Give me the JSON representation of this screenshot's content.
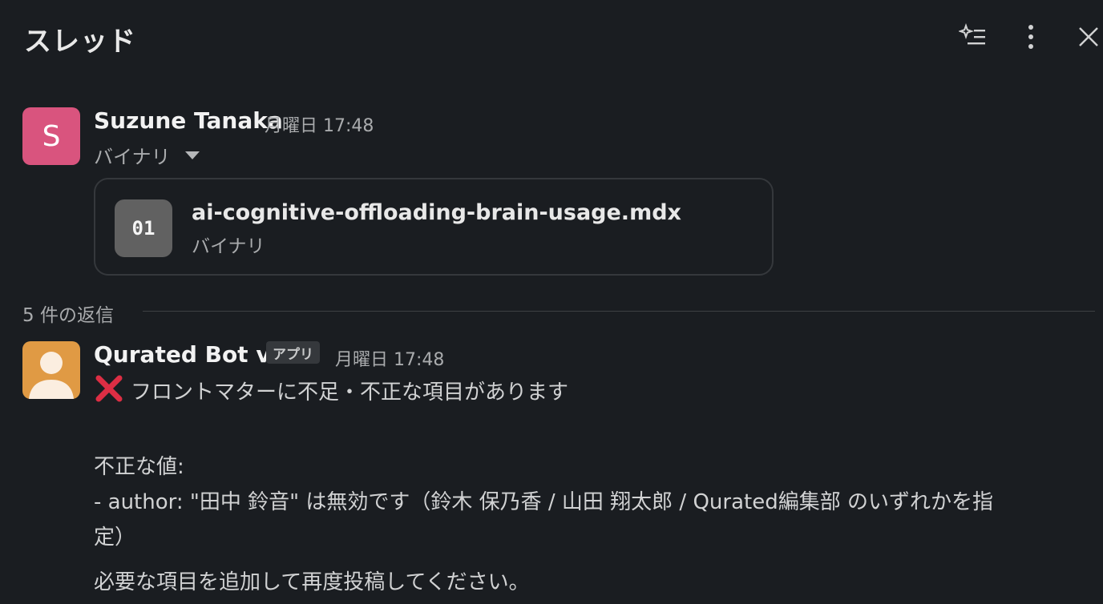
{
  "header": {
    "title": "スレッド",
    "icons": [
      "ai-summary-icon",
      "more-vertical-icon",
      "close-icon"
    ]
  },
  "parent_message": {
    "avatar_letter": "S",
    "avatar_color": "#d9547e",
    "author": "Suzune Tanaka",
    "timestamp": "月曜日 17:48",
    "subline": "バイナリ",
    "file": {
      "icon_label": "01",
      "name": "ai-cognitive-offloading-brain-usage.mdx",
      "type": "バイナリ"
    }
  },
  "replies": {
    "count_label": "5 件の返信"
  },
  "reply_message": {
    "author": "Qurated Bot v2",
    "badge": "アプリ",
    "timestamp": "月曜日 17:48",
    "avatar_color": "#e09a44",
    "lines": {
      "headline": "フロントマターに不足・不正な項目があります",
      "invalid_label": "不正な値:",
      "invalid_detail_1": "- author: \"田中 鈴音\" は無効です（鈴木 保乃香 / 山田 翔太郎 / Qurated編集部 のいずれかを指",
      "invalid_detail_2": "定）",
      "request": "必要な項目を追加して再度投稿してください。"
    }
  }
}
